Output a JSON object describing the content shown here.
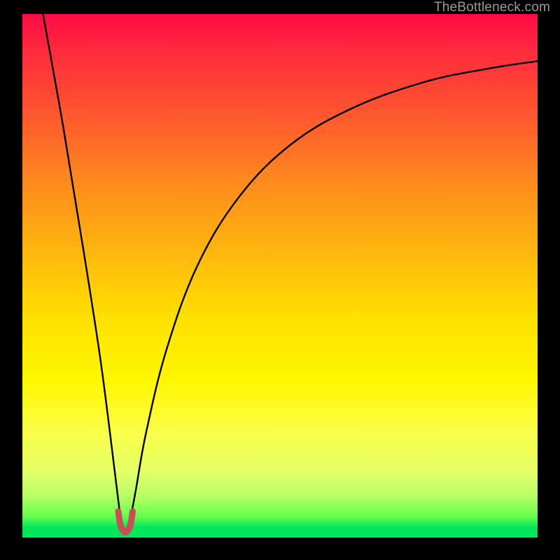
{
  "watermark": {
    "text": "TheBottleneck.com"
  },
  "colors": {
    "background": "#000000",
    "curve_stroke": "#000000",
    "marker_stroke": "#c94f57",
    "gradient_stops": [
      "#ff0b46",
      "#ff2a3d",
      "#ff5a2e",
      "#ff8a1e",
      "#ffb50e",
      "#ffe000",
      "#fff700",
      "#faff4a",
      "#e6ff66",
      "#b8ff66",
      "#66ff4d",
      "#00e85a"
    ]
  },
  "chart_data": {
    "type": "line",
    "title": "",
    "xlabel": "",
    "ylabel": "",
    "x_range": [
      0,
      100
    ],
    "y_range": [
      0,
      100
    ],
    "description": "Single V-shaped curve: steep near-linear descent from top-left to a cusp near the bottom (around x≈20), then a concave-increasing rise toward the upper right. Gradient background maps y (0=bottom=green) to (100=top=red). A short U-shaped highlighted segment sits at the cusp.",
    "series": [
      {
        "name": "bottleneck-curve",
        "points": [
          {
            "x": 4,
            "y": 100
          },
          {
            "x": 8,
            "y": 78
          },
          {
            "x": 12,
            "y": 54
          },
          {
            "x": 15,
            "y": 35
          },
          {
            "x": 17,
            "y": 20
          },
          {
            "x": 18.5,
            "y": 8
          },
          {
            "x": 19.2,
            "y": 3
          },
          {
            "x": 20.0,
            "y": 1
          },
          {
            "x": 20.8,
            "y": 3
          },
          {
            "x": 22,
            "y": 9
          },
          {
            "x": 24,
            "y": 20
          },
          {
            "x": 28,
            "y": 36
          },
          {
            "x": 34,
            "y": 52
          },
          {
            "x": 42,
            "y": 65
          },
          {
            "x": 52,
            "y": 75
          },
          {
            "x": 64,
            "y": 82
          },
          {
            "x": 78,
            "y": 87
          },
          {
            "x": 90,
            "y": 89.5
          },
          {
            "x": 100,
            "y": 91
          }
        ]
      }
    ],
    "marker": {
      "name": "cusp-highlight",
      "shape": "U",
      "points": [
        {
          "x": 18.6,
          "y": 5.0
        },
        {
          "x": 19.0,
          "y": 2.5
        },
        {
          "x": 19.5,
          "y": 1.4
        },
        {
          "x": 20.0,
          "y": 1.0
        },
        {
          "x": 20.5,
          "y": 1.4
        },
        {
          "x": 21.0,
          "y": 2.5
        },
        {
          "x": 21.4,
          "y": 5.0
        }
      ]
    }
  }
}
